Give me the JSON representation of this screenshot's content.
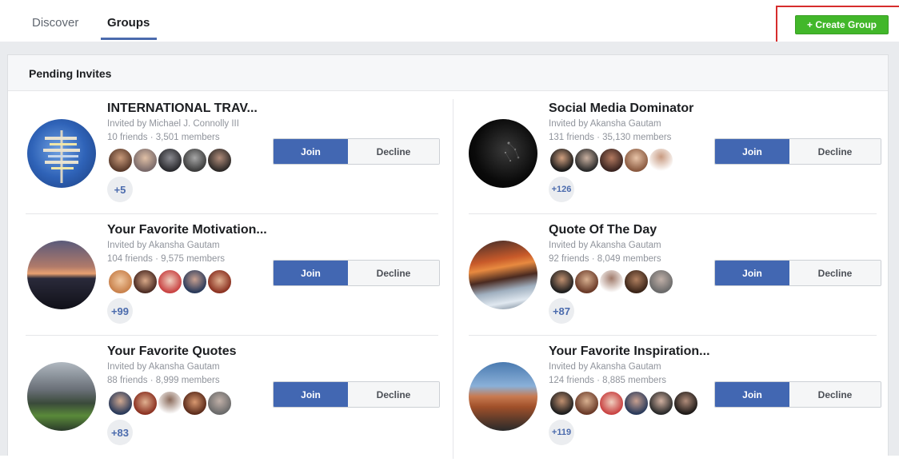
{
  "tabs": [
    {
      "label": "Discover"
    },
    {
      "label": "Groups"
    }
  ],
  "create_group_label": "+ Create Group",
  "section_title": "Pending Invites",
  "buttons": {
    "join": "Join",
    "decline": "Decline"
  },
  "groups": [
    {
      "name": "INTERNATIONAL TRAV...",
      "invited_by": "Invited by Michael J. Connolly III",
      "stats": "10 friends · 3,501 members",
      "more": "+5"
    },
    {
      "name": "Social Media Dominator",
      "invited_by": "Invited by Akansha Gautam",
      "stats": "131 friends · 35,130 members",
      "more": "+126"
    },
    {
      "name": "Your Favorite Motivation...",
      "invited_by": "Invited by Akansha Gautam",
      "stats": "104 friends · 9,575 members",
      "more": "+99"
    },
    {
      "name": "Quote Of The Day",
      "invited_by": "Invited by Akansha Gautam",
      "stats": "92 friends · 8,049 members",
      "more": "+87"
    },
    {
      "name": "Your Favorite Quotes",
      "invited_by": "Invited by Akansha Gautam",
      "stats": "88 friends · 8,999 members",
      "more": "+83"
    },
    {
      "name": "Your Favorite Inspiration...",
      "invited_by": "Invited by Akansha Gautam",
      "stats": "124 friends · 8,885 members",
      "more": "+119"
    }
  ],
  "colors": {
    "create_button": "#42b72a",
    "highlight_box": "#d62d2d",
    "join_button": "#4267b2"
  }
}
